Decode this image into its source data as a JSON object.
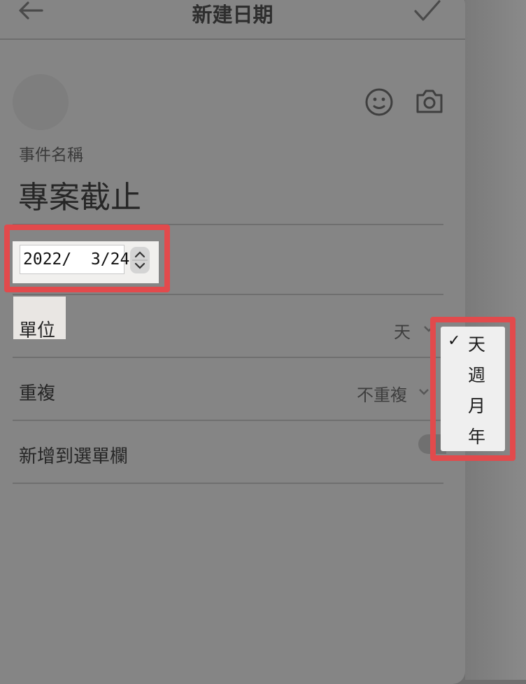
{
  "header": {
    "title": "新建日期",
    "back_icon": "arrow-left-icon",
    "confirm_icon": "checkmark-icon"
  },
  "form": {
    "toolbar_icons": [
      "emoji-face-icon",
      "camera-icon"
    ],
    "event_name_label": "事件名稱",
    "event_name_value": "專案截止",
    "date_value": "2022/  3/24",
    "unit_label": "單位",
    "unit_value": "天",
    "repeat_label": "重複",
    "repeat_value": "不重複",
    "menubar_label": "新增到選單欄"
  },
  "unit_menu": {
    "items": [
      {
        "label": "天",
        "checked": true
      },
      {
        "label": "週",
        "checked": false
      },
      {
        "label": "月",
        "checked": false
      },
      {
        "label": "年",
        "checked": false
      }
    ],
    "check_glyph": "✓"
  },
  "colors": {
    "highlight": "#e24a4c",
    "overlay": "#858585"
  }
}
